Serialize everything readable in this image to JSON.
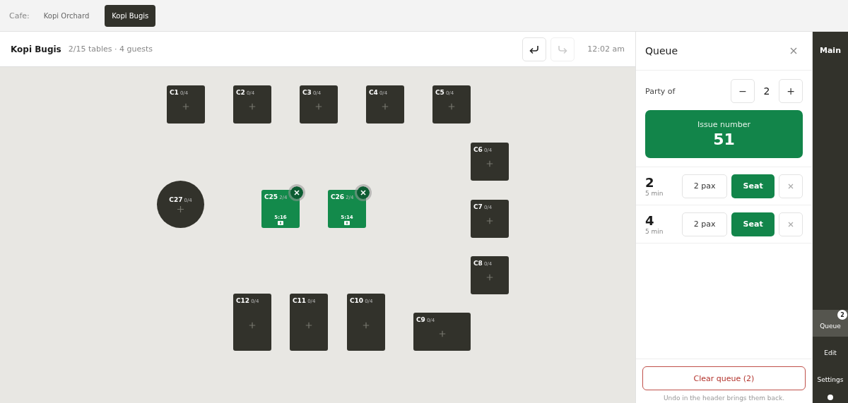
{
  "cafe_bar": {
    "label": "Cafe:",
    "cafes": [
      {
        "label": "Kopi Orchard",
        "selected": false
      },
      {
        "label": "Kopi Bugis",
        "selected": true
      }
    ]
  },
  "header": {
    "title": "Kopi Bugis",
    "summary": "2/15 tables · 4 guests",
    "undo": {
      "disabled": false
    },
    "redo": {
      "disabled": true
    },
    "time": "12:02 am"
  },
  "tables": [
    {
      "name": "C1",
      "seats": "0/4",
      "kind": "square",
      "occupied": false
    },
    {
      "name": "C2",
      "seats": "0/4",
      "kind": "square",
      "occupied": false
    },
    {
      "name": "C3",
      "seats": "0/4",
      "kind": "square",
      "occupied": false
    },
    {
      "name": "C4",
      "seats": "0/4",
      "kind": "square",
      "occupied": false
    },
    {
      "name": "C5",
      "seats": "0/4",
      "kind": "square",
      "occupied": false
    },
    {
      "name": "C6",
      "seats": "0/4",
      "kind": "square",
      "occupied": false
    },
    {
      "name": "C7",
      "seats": "0/4",
      "kind": "square",
      "occupied": false
    },
    {
      "name": "C8",
      "seats": "0/4",
      "kind": "square",
      "occupied": false
    },
    {
      "name": "C27",
      "seats": "0/4",
      "kind": "round",
      "occupied": false
    },
    {
      "name": "C25",
      "seats": "2/4",
      "kind": "square",
      "occupied": true,
      "time": "5:16"
    },
    {
      "name": "C26",
      "seats": "2/4",
      "kind": "square",
      "occupied": true,
      "time": "5:14"
    },
    {
      "name": "C12",
      "seats": "0/4",
      "kind": "tall",
      "occupied": false
    },
    {
      "name": "C11",
      "seats": "0/4",
      "kind": "tall",
      "occupied": false
    },
    {
      "name": "C10",
      "seats": "0/4",
      "kind": "tall",
      "occupied": false
    },
    {
      "name": "C9",
      "seats": "0/4",
      "kind": "wide",
      "occupied": false
    }
  ],
  "queue": {
    "title": "Queue",
    "party_label": "Party of",
    "party_size": "2",
    "decrement": "−",
    "increment": "+",
    "issue_label": "Issue number",
    "issue_number": "51",
    "entries": [
      {
        "number": "2",
        "wait": "5 min",
        "pax": "2 pax",
        "seat": "Seat"
      },
      {
        "number": "4",
        "wait": "5 min",
        "pax": "2 pax",
        "seat": "Seat"
      }
    ],
    "clear": "Clear queue (2)",
    "note": "Undo in the header brings them back."
  },
  "nav": {
    "title": "Main",
    "items": [
      {
        "label": "Queue",
        "selected": true,
        "badge": "2"
      },
      {
        "label": "Edit",
        "selected": false
      },
      {
        "label": "Settings",
        "selected": false
      }
    ]
  }
}
